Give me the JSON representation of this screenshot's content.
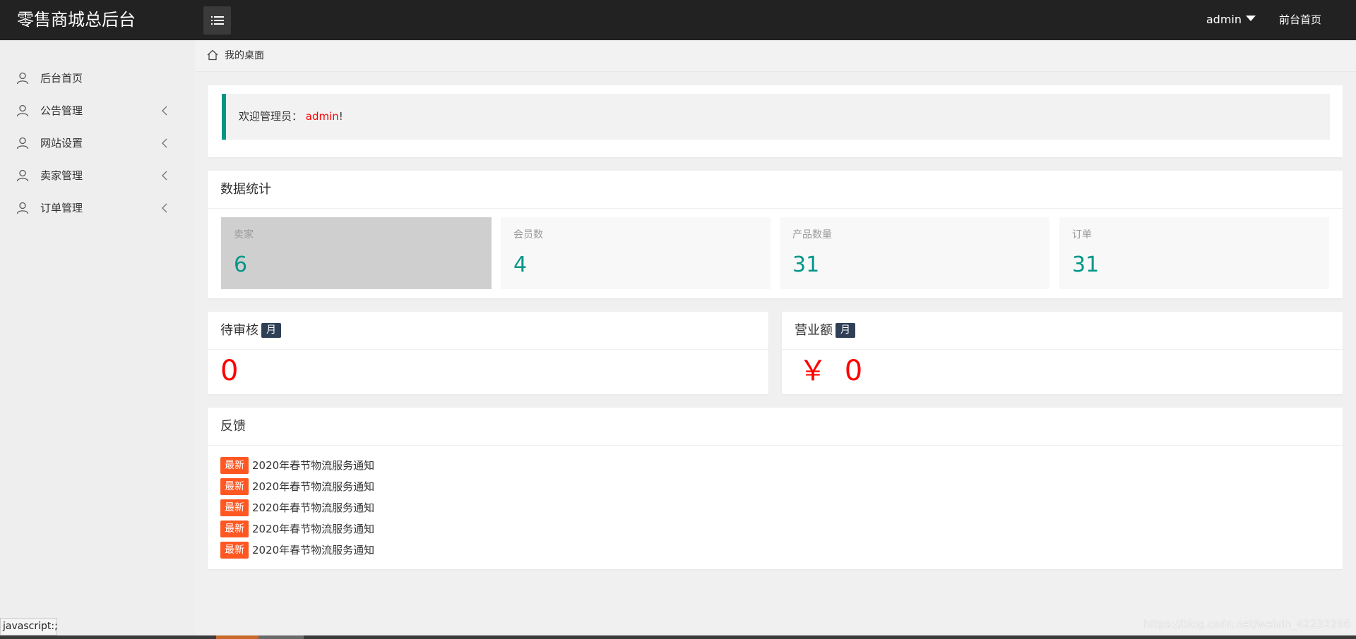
{
  "header": {
    "brand": "零售商城总后台",
    "user_name": "admin",
    "front_link": "前台首页"
  },
  "sidebar": {
    "items": [
      {
        "label": "后台首页",
        "icon": "user-icon",
        "expandable": false
      },
      {
        "label": "公告管理",
        "icon": "user-icon",
        "expandable": true
      },
      {
        "label": "网站设置",
        "icon": "user-icon",
        "expandable": true
      },
      {
        "label": "卖家管理",
        "icon": "user-icon",
        "expandable": true
      },
      {
        "label": "订单管理",
        "icon": "user-icon",
        "expandable": true
      }
    ]
  },
  "breadcrumb": {
    "label": "我的桌面",
    "icon": "home-icon"
  },
  "welcome": {
    "prefix": "欢迎管理员：",
    "name": "admin",
    "suffix": "!"
  },
  "stats": {
    "title": "数据统计",
    "items": [
      {
        "label": "卖家",
        "value": "6"
      },
      {
        "label": "会员数",
        "value": "4"
      },
      {
        "label": "产品数量",
        "value": "31"
      },
      {
        "label": "订单",
        "value": "31"
      }
    ]
  },
  "pending": {
    "title": "待审核",
    "badge": "月",
    "value": "0"
  },
  "revenue": {
    "title": "营业额",
    "badge": "月",
    "currency": "￥",
    "value": "0"
  },
  "feedback": {
    "title": "反馈",
    "items": [
      {
        "tag": "最新",
        "text": "2020年春节物流服务通知"
      },
      {
        "tag": "最新",
        "text": "2020年春节物流服务通知"
      },
      {
        "tag": "最新",
        "text": "2020年春节物流服务通知"
      },
      {
        "tag": "最新",
        "text": "2020年春节物流服务通知"
      },
      {
        "tag": "最新",
        "text": "2020年春节物流服务通知"
      }
    ]
  },
  "statusbar": {
    "text": "javascript:;"
  },
  "watermark": {
    "text": "https://blog.csdn.net/weixin_42232296"
  },
  "colors": {
    "accent": "#009688",
    "header": "#222222",
    "tag": "#ff5722",
    "alert": "#ff0000",
    "badge": "#2f4056"
  }
}
